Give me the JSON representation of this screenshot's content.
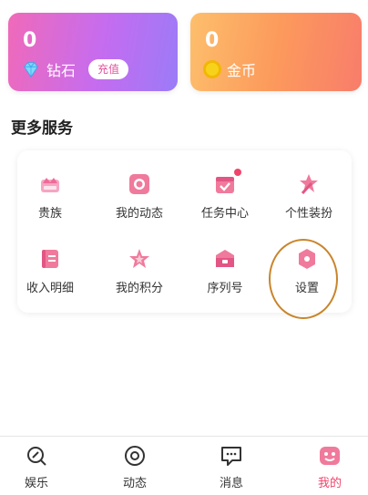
{
  "wallet": {
    "diamond": {
      "value": "0",
      "label": "钻石",
      "recharge_label": "充值",
      "icon": "diamond-icon"
    },
    "coin": {
      "value": "0",
      "label": "金币",
      "icon": "coin-icon"
    }
  },
  "section_title": "更多服务",
  "services": [
    {
      "label": "贵族",
      "icon": "crown-icon",
      "badge": false
    },
    {
      "label": "我的动态",
      "icon": "camera-icon",
      "badge": false
    },
    {
      "label": "任务中心",
      "icon": "task-calendar-icon",
      "badge": true
    },
    {
      "label": "个性装扮",
      "icon": "dress-up-icon",
      "badge": false
    },
    {
      "label": "收入明细",
      "icon": "ledger-icon",
      "badge": false
    },
    {
      "label": "我的积分",
      "icon": "star-icon",
      "badge": false
    },
    {
      "label": "序列号",
      "icon": "serial-box-icon",
      "badge": false
    },
    {
      "label": "设置",
      "icon": "settings-hex-icon",
      "badge": false
    }
  ],
  "tabs": [
    {
      "label": "娱乐",
      "icon": "entertainment-icon",
      "active": false
    },
    {
      "label": "动态",
      "icon": "moments-icon",
      "active": false
    },
    {
      "label": "消息",
      "icon": "message-icon",
      "active": false
    },
    {
      "label": "我的",
      "icon": "profile-icon",
      "active": true
    }
  ],
  "colors": {
    "accent": "#f0446b",
    "diamond_card_start": "#f06ab9",
    "diamond_card_end": "#9b7bf7",
    "coin_card_start": "#fdbf6c",
    "coin_card_end": "#f87d6b",
    "highlight_ring": "#c9852c"
  }
}
